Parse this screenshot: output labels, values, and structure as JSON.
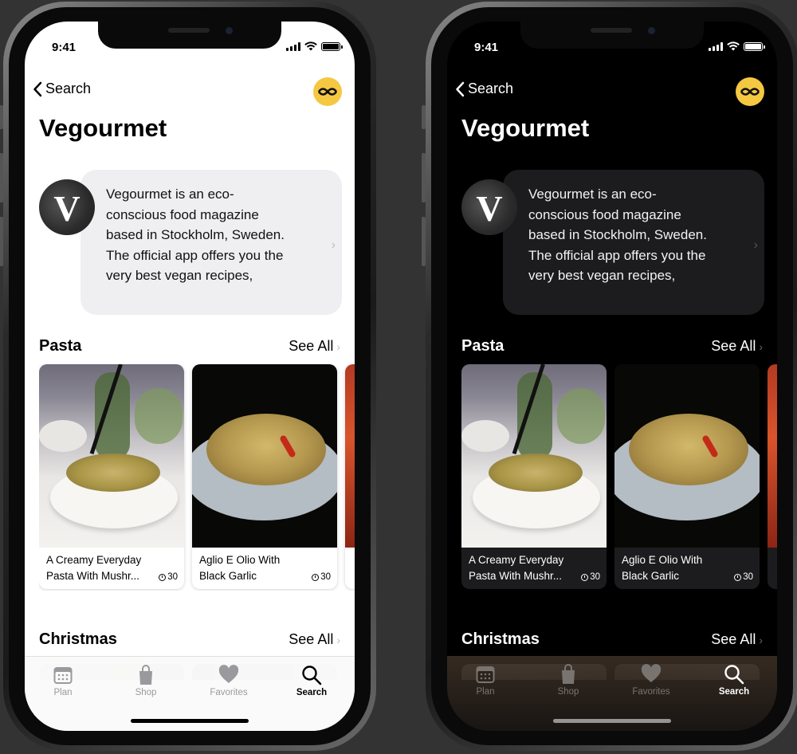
{
  "status_bar": {
    "time": "9:41"
  },
  "nav": {
    "back_label": "Search",
    "logo_icon": "cross-logo-icon",
    "logo_color": "#f5c842"
  },
  "page": {
    "title": "Vegourmet"
  },
  "intro": {
    "avatar_letter": "V",
    "lines": [
      "Vegourmet is an eco-",
      "conscious food magazine",
      "based in Stockholm, Sweden.",
      "The official app offers you the",
      "very best vegan recipes,"
    ]
  },
  "sections": [
    {
      "name": "Pasta",
      "see_all": "See All",
      "cards": [
        {
          "line1": "A Creamy Everyday",
          "line2": "Pasta With Mushr...",
          "duration": "30"
        },
        {
          "line1": "Aglio E Olio With",
          "line2": "Black Garlic",
          "duration": "30"
        }
      ]
    },
    {
      "name": "Christmas",
      "see_all": "See All"
    }
  ],
  "tabbar": {
    "tabs": [
      {
        "label": "Plan",
        "icon": "calendar-icon"
      },
      {
        "label": "Shop",
        "icon": "shopping-bag-icon"
      },
      {
        "label": "Favorites",
        "icon": "heart-icon"
      },
      {
        "label": "Search",
        "icon": "search-icon",
        "active": true
      }
    ]
  },
  "themes": {
    "light_bg": "#ffffff",
    "dark_bg": "#000000",
    "desktop_bg": "#333333"
  }
}
